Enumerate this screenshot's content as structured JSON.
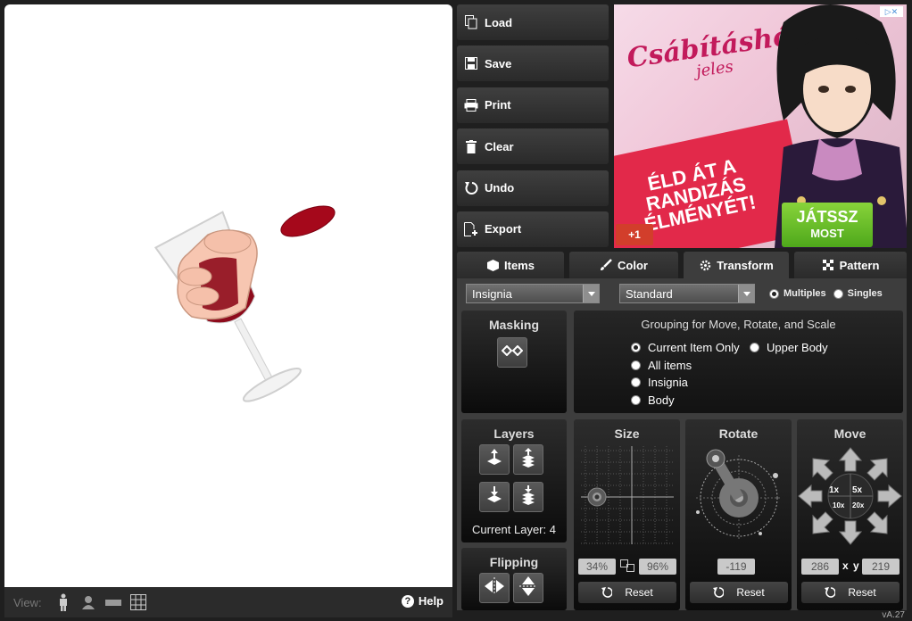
{
  "toolbar": {
    "load": "Load",
    "save": "Save",
    "print": "Print",
    "clear": "Clear",
    "undo": "Undo",
    "export": "Export"
  },
  "ad": {
    "brand": "Csábításhól",
    "brand_sub": "jeles",
    "slogan": "ÉLD ÁT A RANDIZÁS ÉLMÉNYÉT!",
    "play_line1": "JÁTSSZ",
    "play_line2": "MOST",
    "gplus": "+1",
    "adchoice": "▷✕"
  },
  "tabs": [
    {
      "label": "Items",
      "icon": "cube-icon"
    },
    {
      "label": "Color",
      "icon": "brush-icon"
    },
    {
      "label": "Transform",
      "icon": "gear-icon"
    },
    {
      "label": "Pattern",
      "icon": "checker-icon"
    }
  ],
  "controls": {
    "category_select": "Insignia",
    "style_select": "Standard",
    "multiples": "Multiples",
    "singles": "Singles"
  },
  "masking": {
    "title": "Masking"
  },
  "grouping": {
    "title": "Grouping for Move, Rotate, and Scale",
    "options": [
      "Current Item Only",
      "Upper Body",
      "All items",
      "Insignia",
      "Body"
    ]
  },
  "layers": {
    "title": "Layers",
    "current": "Current Layer: 4"
  },
  "flipping": {
    "title": "Flipping"
  },
  "size": {
    "title": "Size",
    "width": "34",
    "width_unit": "%",
    "height": "96",
    "height_unit": "%",
    "reset": "Reset"
  },
  "rotate": {
    "title": "Rotate",
    "value": "-119",
    "reset": "Reset"
  },
  "move": {
    "title": "Move",
    "x": "286",
    "x_label": "x",
    "y_label": "y",
    "y": "219",
    "reset": "Reset",
    "steps": [
      "1x",
      "5x",
      "10x",
      "20x"
    ]
  },
  "viewbar": {
    "label": "View:",
    "help": "Help"
  },
  "version": "vA.27"
}
